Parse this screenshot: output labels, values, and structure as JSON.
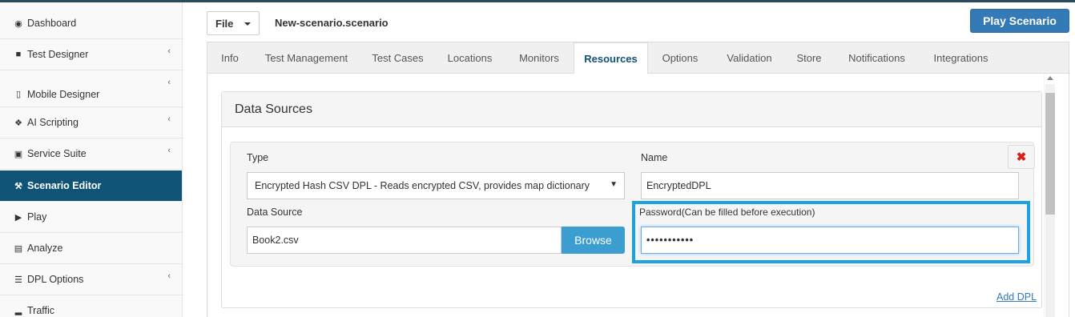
{
  "sidebar": {
    "items": [
      {
        "label": "Dashboard",
        "icon": "dashboard-icon",
        "has_submenu": false
      },
      {
        "label": "Test Designer",
        "icon": "video-camera-icon",
        "has_submenu": true
      },
      {
        "label": "Mobile Designer",
        "icon": "mobile-icon",
        "has_submenu": true
      },
      {
        "label": "AI Scripting",
        "icon": "cubes-icon",
        "has_submenu": true
      },
      {
        "label": "Service Suite",
        "icon": "briefcase-icon",
        "has_submenu": true
      },
      {
        "label": "Scenario Editor",
        "icon": "wrench-icon",
        "has_submenu": false,
        "active": true
      },
      {
        "label": "Play",
        "icon": "play-icon",
        "has_submenu": false
      },
      {
        "label": "Analyze",
        "icon": "bar-chart-icon",
        "has_submenu": false
      },
      {
        "label": "DPL Options",
        "icon": "list-icon",
        "has_submenu": true
      },
      {
        "label": "Traffic",
        "icon": "signal-icon",
        "has_submenu": false
      }
    ]
  },
  "toolbar": {
    "file_label": "File",
    "scenario_name": "New-scenario.scenario",
    "play_label": "Play Scenario"
  },
  "tabs": [
    {
      "label": "Info"
    },
    {
      "label": "Test Management"
    },
    {
      "label": "Test Cases"
    },
    {
      "label": "Locations"
    },
    {
      "label": "Monitors"
    },
    {
      "label": "Resources",
      "active": true
    },
    {
      "label": "Options"
    },
    {
      "label": "Validation"
    },
    {
      "label": "Store"
    },
    {
      "label": "Notifications"
    },
    {
      "label": "Integrations"
    }
  ],
  "data_sources": {
    "title": "Data Sources",
    "type_label": "Type",
    "type_value": "Encrypted Hash CSV DPL - Reads encrypted CSV, provides map dictionary",
    "name_label": "Name",
    "name_value": "EncryptedDPL",
    "source_label": "Data Source",
    "source_value": "Book2.csv",
    "browse_label": "Browse",
    "password_label": "Password(Can be filled before execution)",
    "password_value": "•••••••••••",
    "remove_symbol": "✖",
    "add_dpl_label": "Add DPL"
  },
  "colors": {
    "active_sidebar": "#0f5377",
    "primary_button": "#337ab7",
    "browse_button": "#3c9dd0",
    "highlight_border": "#1aa3e0",
    "remove_icon": "#d9201b"
  }
}
